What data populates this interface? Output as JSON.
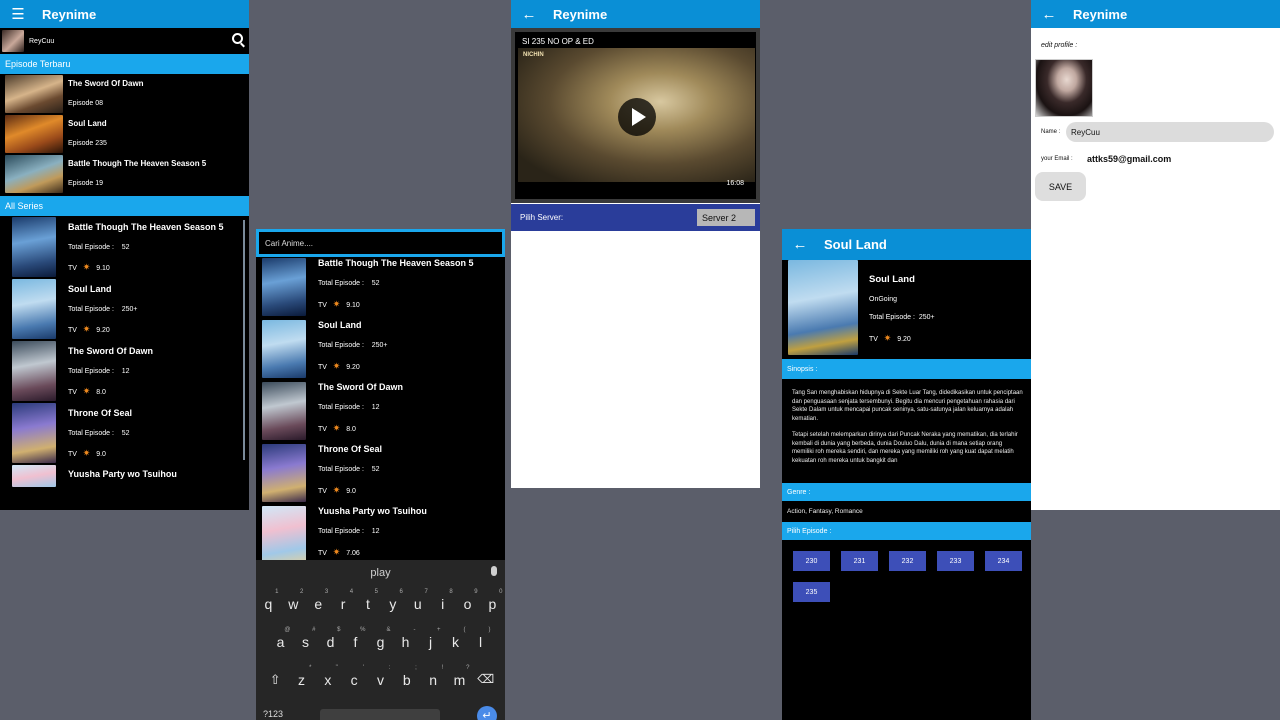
{
  "colors": {
    "accent": "#0a8fd6",
    "section": "#1aa7ec",
    "server_bar": "#2a3d9a",
    "episode_button": "#3d4fb8",
    "star": "#f08a1e",
    "page_bg": "#5b5e6a"
  },
  "screen1": {
    "app_title": "Reynime",
    "username": "ReyCuu",
    "section_new": "Episode Terbaru",
    "new_episodes": [
      {
        "title": "The Sword Of Dawn",
        "episode": "Episode 08"
      },
      {
        "title": "Soul Land",
        "episode": "Episode 235"
      },
      {
        "title": "Battle Though The Heaven Season 5",
        "episode": "Episode 19"
      }
    ],
    "section_all": "All Series",
    "series": [
      {
        "title": "Battle Though The Heaven Season 5",
        "ep_label": "Total Episode :",
        "ep": "52",
        "type": "TV",
        "rating": "9.10"
      },
      {
        "title": "Soul Land",
        "ep_label": "Total Episode :",
        "ep": "250+",
        "type": "TV",
        "rating": "9.20"
      },
      {
        "title": "The Sword Of Dawn",
        "ep_label": "Total Episode :",
        "ep": "12",
        "type": "TV",
        "rating": "8.0"
      },
      {
        "title": "Throne Of Seal",
        "ep_label": "Total Episode :",
        "ep": "52",
        "type": "TV",
        "rating": "9.0"
      },
      {
        "title": "Yuusha Party wo Tsuihou"
      }
    ]
  },
  "screen2": {
    "search_placeholder": "Cari Anime....",
    "series": [
      {
        "title": "Battle Though The Heaven Season 5",
        "ep_label": "Total Episode :",
        "ep": "52",
        "type": "TV",
        "rating": "9.10"
      },
      {
        "title": "Soul Land",
        "ep_label": "Total Episode :",
        "ep": "250+",
        "type": "TV",
        "rating": "9.20"
      },
      {
        "title": "The Sword Of Dawn",
        "ep_label": "Total Episode :",
        "ep": "12",
        "type": "TV",
        "rating": "8.0"
      },
      {
        "title": "Throne Of Seal",
        "ep_label": "Total Episode :",
        "ep": "52",
        "type": "TV",
        "rating": "9.0"
      },
      {
        "title": "Yuusha Party wo Tsuihou",
        "ep_label": "Total Episode :",
        "ep": "12",
        "type": "TV",
        "rating": "7.06"
      }
    ],
    "keyboard": {
      "suggestion": "play",
      "row1": [
        "q",
        "w",
        "e",
        "r",
        "t",
        "y",
        "u",
        "i",
        "o",
        "p"
      ],
      "row1_hints": [
        "1",
        "2",
        "3",
        "4",
        "5",
        "6",
        "7",
        "8",
        "9",
        "0"
      ],
      "row2": [
        "a",
        "s",
        "d",
        "f",
        "g",
        "h",
        "j",
        "k",
        "l"
      ],
      "row2_hints": [
        "@",
        "#",
        "$",
        "%",
        "&",
        "-",
        "+",
        "(",
        ")"
      ],
      "row3": [
        "z",
        "x",
        "c",
        "v",
        "b",
        "n",
        "m"
      ],
      "row3_hints": [
        "*",
        "\"",
        "'",
        ":",
        ";",
        "!",
        "?"
      ],
      "numbers_key": "?123"
    }
  },
  "screen3": {
    "app_title": "Reynime",
    "video_title": "SI 235 NO OP & ED",
    "channel": "NICHIN",
    "duration": "16:08",
    "server_label": "Pilih Server:",
    "server_value": "Server 2"
  },
  "screen4": {
    "app_title": "Soul Land",
    "title": "Soul Land",
    "status": "OnGoing",
    "ep_label": "Total Episode :",
    "ep": "250+",
    "type": "TV",
    "rating": "9.20",
    "synopsis_label": "Sinopsis :",
    "synopsis_p1": "Tang San menghabiskan hidupnya di Sekte Luar Tang, didedikasikan untuk penciptaan dan penguasaan senjata tersembunyi. Begitu dia mencuri pengetahuan rahasia dari Sekte Dalam untuk mencapai puncak seninya, satu-satunya jalan keluarnya adalah kematian.",
    "synopsis_p2": "Tetapi setelah melemparkan dirinya dari Puncak Neraka yang mematikan, dia terlahir kembali di dunia yang berbeda, dunia Douluo Dalu, dunia di mana setiap orang memiliki roh mereka sendiri, dan mereka yang memiliki roh yang kuat dapat melatih kekuatan roh mereka untuk bangkit dan",
    "genre_label": "Genre :",
    "genre": "Action, Fantasy, Romance",
    "episode_label": "Pilih Episode :",
    "episodes": [
      "230",
      "231",
      "232",
      "233",
      "234",
      "235"
    ]
  },
  "screen5": {
    "app_title": "Reynime",
    "edit_label": "edit profile :",
    "name_label": "Name :",
    "name_value": "ReyCuu",
    "email_label": "your Email :",
    "email_value": "attks59@gmail.com",
    "save_label": "SAVE"
  }
}
